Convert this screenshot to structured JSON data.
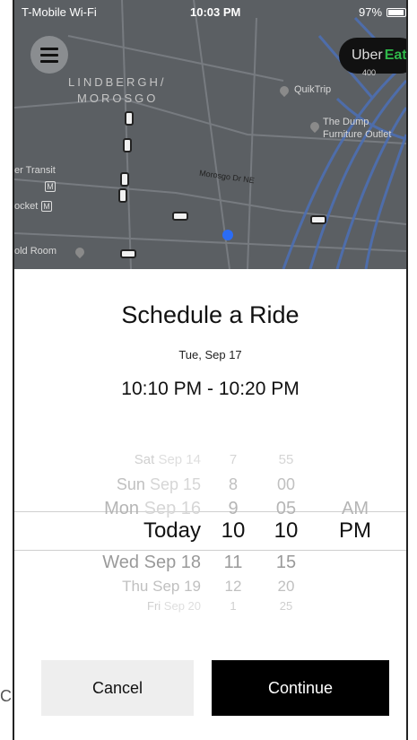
{
  "status_bar": {
    "carrier": "T-Mobile Wi-Fi",
    "time": "10:03 PM",
    "battery": "97%"
  },
  "map": {
    "uber_eats": {
      "uber": "Uber",
      "eats": "Eats"
    },
    "labels": {
      "neighborhood_1": "LINDBERGH/",
      "neighborhood_2": "MOROSGO",
      "quiktrip": "QuikTrip",
      "route_badge": "400",
      "dump_1": "The Dump",
      "dump_2": "Furniture Outlet",
      "transit": "er Transit",
      "transit_icon": "M",
      "pocket": "ocket",
      "pocket_icon": "M",
      "street": "Morosgo Dr NE",
      "gold_room": "old Room"
    },
    "icons": [
      "menu-icon",
      "location-pin-icon",
      "car-icon",
      "user-location-icon"
    ]
  },
  "sheet": {
    "title": "Schedule a Ride",
    "date": "Tue, Sep 17",
    "time_range": "10:10 PM - 10:20 PM"
  },
  "picker": {
    "dates": [
      {
        "day": "Sat",
        "month": "Sep 14"
      },
      {
        "day": "Sun",
        "month": "Sep 15"
      },
      {
        "day": "Mon",
        "month": "Sep 16"
      },
      {
        "day": "Today",
        "month": ""
      },
      {
        "day": "Wed",
        "month": "Sep 18"
      },
      {
        "day": "Thu",
        "month": "Sep 19"
      },
      {
        "day": "Fri",
        "month": "Sep 20"
      }
    ],
    "hours": [
      "7",
      "8",
      "9",
      "10",
      "11",
      "12",
      "1"
    ],
    "minutes": [
      "55",
      "00",
      "05",
      "10",
      "15",
      "20",
      "25"
    ],
    "ampm": [
      "AM",
      "PM"
    ],
    "selected": {
      "date": "Today",
      "hour": "10",
      "minute": "10",
      "ampm": "PM"
    }
  },
  "buttons": {
    "cancel": "Cancel",
    "continue": "Continue"
  },
  "stray_text": "C"
}
